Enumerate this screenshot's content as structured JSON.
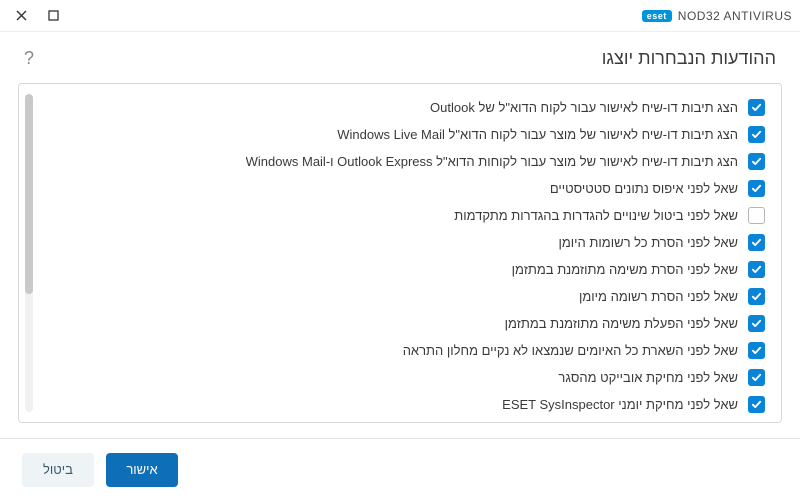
{
  "titlebar": {
    "brand_badge": "eset",
    "product": "NOD32 ANTIVIRUS"
  },
  "header": {
    "title": "ההודעות הנבחרות יוצגו",
    "help_glyph": "?"
  },
  "items": [
    {
      "label": "הצג תיבות דו-שיח לאישור עבור לקוח הדוא\"ל של Outlook",
      "checked": true
    },
    {
      "label": "הצג תיבות דו-שיח לאישור של מוצר עבור לקוח הדוא\"ל Windows Live Mail",
      "checked": true
    },
    {
      "label": "הצג תיבות דו-שיח לאישור של מוצר עבור לקוחות הדוא\"ל Outlook Express ו-Windows Mail",
      "checked": true
    },
    {
      "label": "שאל לפני איפוס נתונים סטטיסטיים",
      "checked": true
    },
    {
      "label": "שאל לפני ביטול שינויים להגדרות בהגדרות מתקדמות",
      "checked": false
    },
    {
      "label": "שאל לפני הסרת כל רשומות היומן",
      "checked": true
    },
    {
      "label": "שאל לפני הסרת משימה מתוזמנת במתזמן",
      "checked": true
    },
    {
      "label": "שאל לפני הסרת רשומה מיומן",
      "checked": true
    },
    {
      "label": "שאל לפני הפעלת משימה מתוזמנת במתזמן",
      "checked": true
    },
    {
      "label": "שאל לפני השארת כל האיומים שנמצאו לא נקיים מחלון התראה",
      "checked": true
    },
    {
      "label": "שאל לפני מחיקת אובייקט מהסגר",
      "checked": true
    },
    {
      "label": "שאל לפני מחיקת יומני ESET SysInspector",
      "checked": true
    }
  ],
  "footer": {
    "ok": "אישור",
    "cancel": "ביטול"
  }
}
